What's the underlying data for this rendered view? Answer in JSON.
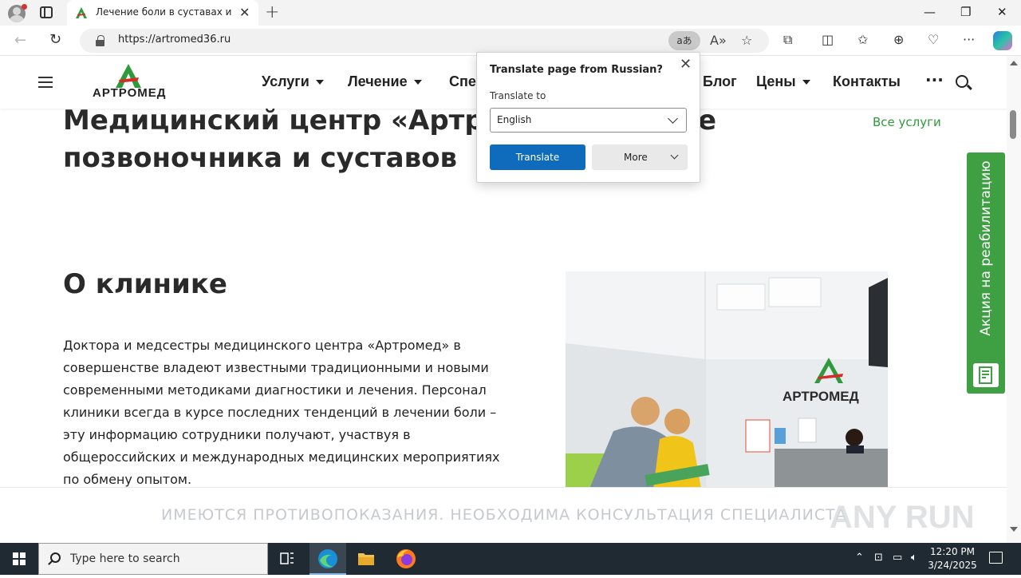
{
  "browser": {
    "tab_title": "Лечение боли в суставах и позвоночнике",
    "url": "https://artromed36.ru",
    "translate_chip": "aあ"
  },
  "site": {
    "logo_text": "АРТРОМЕД",
    "menu": [
      {
        "label": "Услуги",
        "has_dropdown": true
      },
      {
        "label": "Лечение",
        "has_dropdown": true
      },
      {
        "label": "Спе",
        "has_dropdown": false
      },
      {
        "label": "Блог",
        "has_dropdown": false
      },
      {
        "label": "Цены",
        "has_dropdown": true
      },
      {
        "label": "Контакты",
        "has_dropdown": false
      }
    ],
    "more_label": "···",
    "hero_title_line1": "Медицинский центр «Артр",
    "hero_title_line1_tail": "е",
    "hero_title_line2": "позвоночника и суставов",
    "all_services": "Все услуги",
    "about_title": "О клинике",
    "about_text": "Доктора и медсестры медицинского центра «Артромед» в совершенстве владеют известными традиционными  и новыми современными методиками диагностики и лечения. Персонал клиники всегда в курсе последних тенденций в лечении боли – эту информацию сотрудники получают, участвуя в общероссийских и международных медицинских мероприятиях по обмену опытом.",
    "photo_sign": "АРТРОМЕД",
    "promo_text": "Акция на реабилитацию",
    "warning": "ИМЕЮТСЯ ПРОТИВОПОКАЗАНИЯ. НЕОБХОДИМА КОНСУЛЬТАЦИЯ СПЕЦИАЛИСТА",
    "watermark": "ANY RUN",
    "colors": {
      "brand_green": "#3ea043",
      "link_green": "#2e9a3c",
      "logo_red": "#d62b2b"
    }
  },
  "translate_popup": {
    "title": "Translate page from Russian?",
    "label": "Translate to",
    "selected_language": "English",
    "translate_button": "Translate",
    "more_button": "More"
  },
  "taskbar": {
    "search_placeholder": "Type here to search",
    "time": "12:20 PM",
    "date": "3/24/2025"
  }
}
